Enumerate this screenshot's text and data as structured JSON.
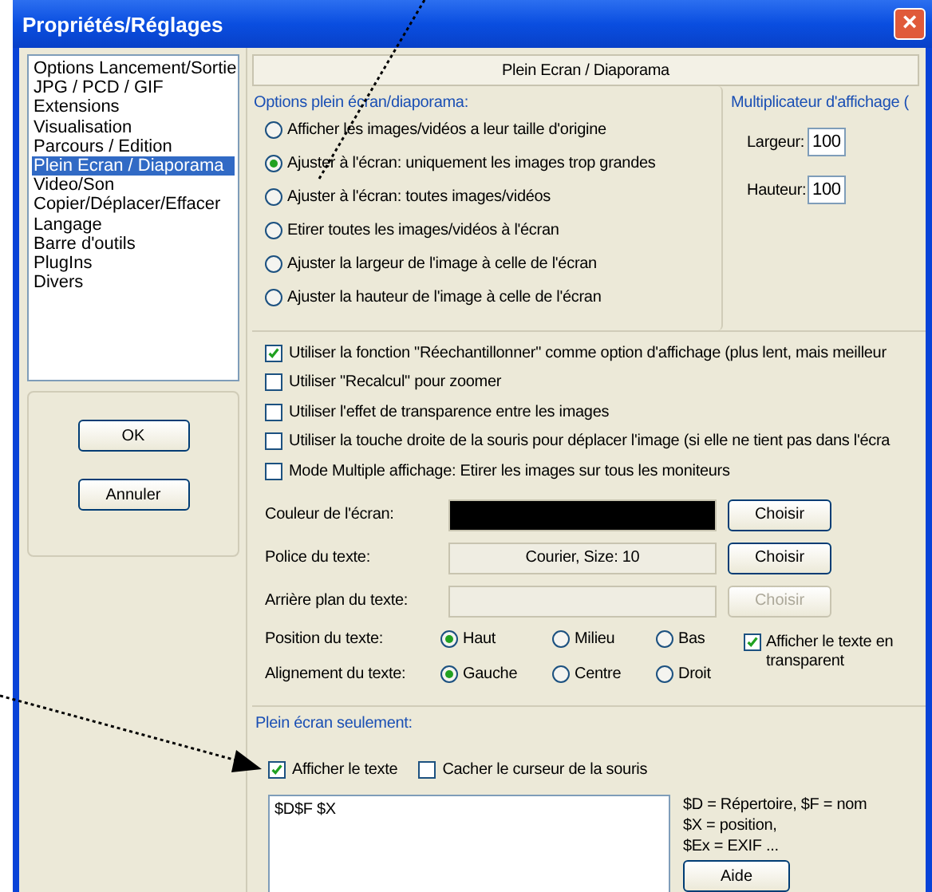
{
  "window": {
    "title": "Propriétés/Réglages",
    "close": "×"
  },
  "sidebar": {
    "items": [
      {
        "label": "Options Lancement/Sortie",
        "selected": false
      },
      {
        "label": "JPG / PCD / GIF",
        "selected": false
      },
      {
        "label": "Extensions",
        "selected": false
      },
      {
        "label": "Visualisation",
        "selected": false
      },
      {
        "label": "Parcours / Edition",
        "selected": false
      },
      {
        "label": "Plein Ecran / Diaporama",
        "selected": true
      },
      {
        "label": "Video/Son",
        "selected": false
      },
      {
        "label": "Copier/Déplacer/Effacer",
        "selected": false
      },
      {
        "label": "Langage",
        "selected": false
      },
      {
        "label": "Barre d'outils",
        "selected": false
      },
      {
        "label": "PlugIns",
        "selected": false
      },
      {
        "label": "Divers",
        "selected": false
      }
    ]
  },
  "buttons": {
    "ok": "OK",
    "cancel": "Annuler"
  },
  "page_title": "Plein Ecran / Diaporama",
  "display_options": {
    "title": "Options plein écran/diaporama:",
    "options": [
      {
        "label": "Afficher les images/vidéos a leur taille d'origine",
        "selected": false
      },
      {
        "label": "Ajuster à l'écran: uniquement les images trop grandes",
        "selected": true
      },
      {
        "label": "Ajuster à l'écran: toutes images/vidéos",
        "selected": false
      },
      {
        "label": "Etirer toutes les images/vidéos à l'écran",
        "selected": false
      },
      {
        "label": "Ajuster la largeur de l'image à celle de l'écran",
        "selected": false
      },
      {
        "label": "Ajuster la hauteur de l'image à celle de l'écran",
        "selected": false
      }
    ]
  },
  "multiplier": {
    "title": "Multiplicateur d'affichage (",
    "fields": [
      {
        "label": "Largeur:",
        "value": "100"
      },
      {
        "label": "Hauteur:",
        "value": "100"
      }
    ]
  },
  "checkboxes": [
    {
      "label": "Utiliser la fonction \"Réechantillonner\" comme option d'affichage (plus lent, mais meilleur",
      "checked": true
    },
    {
      "label": "Utiliser \"Recalcul\" pour zoomer",
      "checked": false
    },
    {
      "label": "Utiliser l'effet de transparence entre les images",
      "checked": false
    },
    {
      "label": "Utiliser la touche droite de la souris pour déplacer l'image (si elle ne tient pas dans l'écra",
      "checked": false
    },
    {
      "label": "Mode Multiple affichage: Etirer les images sur tous les moniteurs",
      "checked": false
    }
  ],
  "settings": [
    {
      "kind": "color",
      "label": "Couleur de l'écran:",
      "color": "#000000",
      "button": "Choisir",
      "disabled": false
    },
    {
      "kind": "text",
      "label": "Police du texte:",
      "value": "Courier, Size: 10",
      "button": "Choisir",
      "disabled": false
    },
    {
      "kind": "text",
      "label": "Arrière plan du texte:",
      "button": "Choisir",
      "disabled": true
    }
  ],
  "position": {
    "label": "Position du texte:",
    "options": [
      {
        "label": "Haut",
        "selected": true
      },
      {
        "label": "Milieu",
        "selected": false
      },
      {
        "label": "Bas",
        "selected": false
      }
    ]
  },
  "alignment": {
    "label": "Alignement du texte:",
    "options": [
      {
        "label": "Gauche",
        "selected": true
      },
      {
        "label": "Centre",
        "selected": false
      },
      {
        "label": "Droit",
        "selected": false
      }
    ]
  },
  "transparent": {
    "label": "Afficher le texte en transparent",
    "checked": true
  },
  "fullscreen": {
    "title": "Plein écran seulement:",
    "checkboxes": [
      {
        "label": "Afficher le texte",
        "checked": true
      },
      {
        "label": "Cacher le curseur de la souris",
        "checked": false
      }
    ],
    "text_value": "$D$F $X",
    "help_lines": [
      "$D = Répertoire, $F = nom",
      "$X = position,",
      "$Ex = EXIF ..."
    ],
    "help_button": "Aide"
  }
}
